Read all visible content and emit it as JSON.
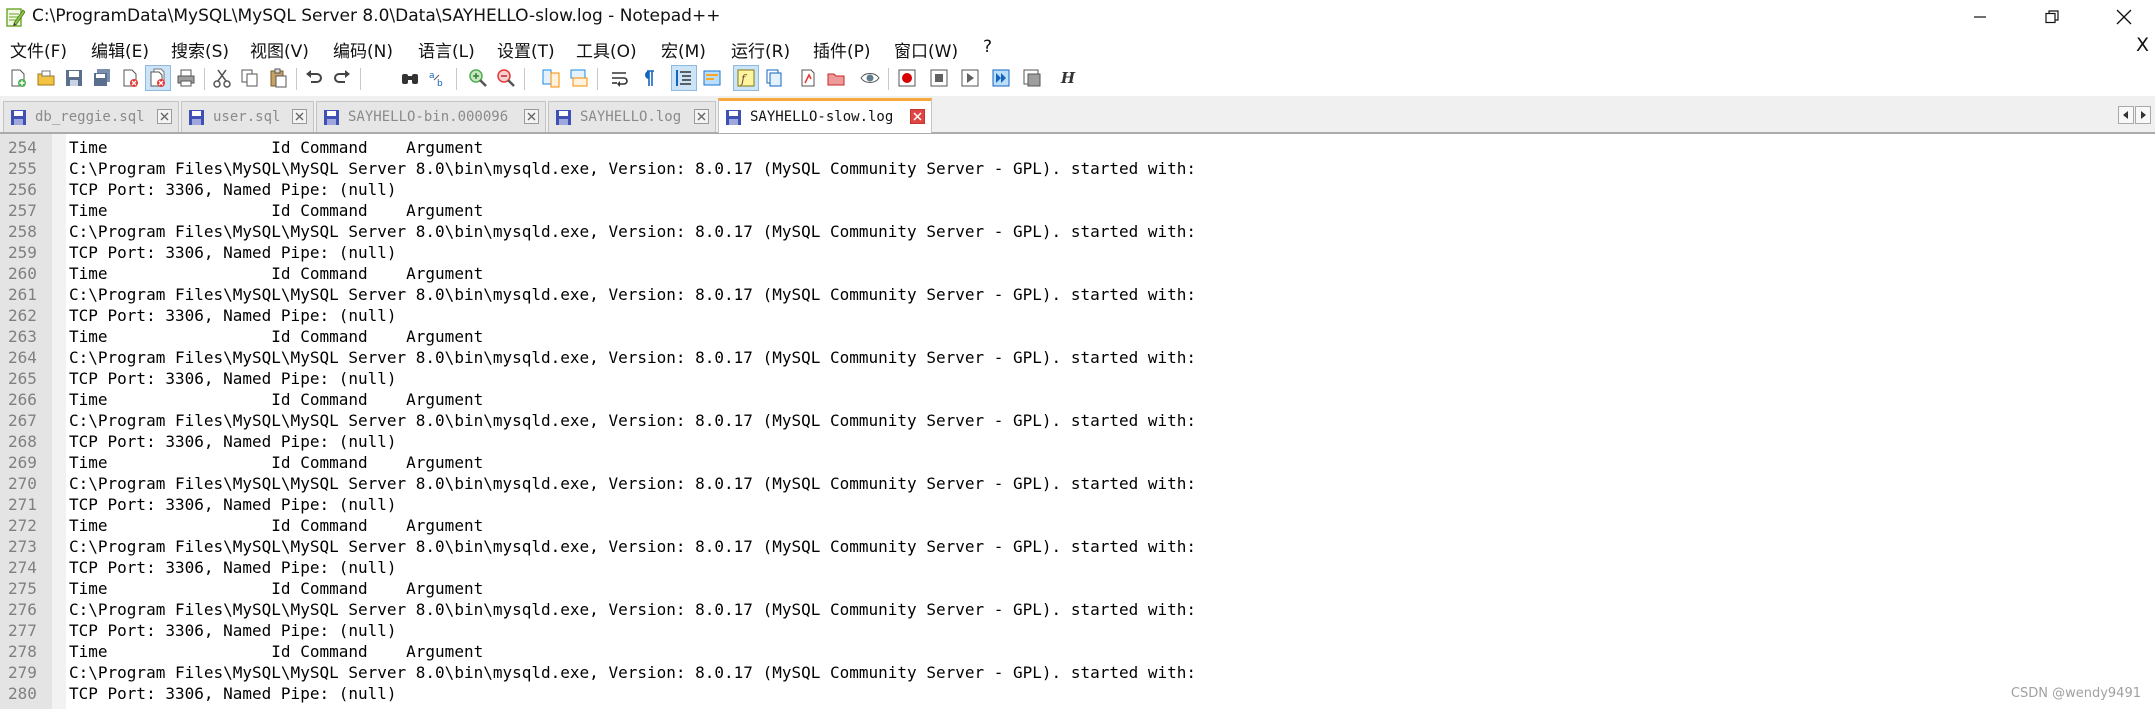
{
  "window": {
    "title": "C:\\ProgramData\\MySQL\\MySQL Server 8.0\\Data\\SAYHELLO-slow.log - Notepad++",
    "minimize": "minimize",
    "maximize": "restore",
    "close": "close"
  },
  "menu": {
    "items": [
      "文件(F)",
      "编辑(E)",
      "搜索(S)",
      "视图(V)",
      "编码(N)",
      "语言(L)",
      "设置(T)",
      "工具(O)",
      "宏(M)",
      "运行(R)",
      "插件(P)",
      "窗口(W)",
      "?"
    ],
    "close_label": "X"
  },
  "toolbar": {
    "icons": [
      "new-file-icon",
      "open-file-icon",
      "save-icon",
      "save-all-icon",
      "close-icon",
      "close-all-icon",
      "print-icon",
      "cut-icon",
      "copy-icon",
      "paste-icon",
      "undo-icon",
      "redo-icon",
      "find-icon",
      "replace-icon",
      "zoom-in-icon",
      "zoom-out-icon",
      "sync-vertical-icon",
      "sync-horizontal-icon",
      "word-wrap-icon",
      "show-all-chars-icon",
      "indent-guide-icon",
      "doc-map-icon",
      "function-list-icon",
      "folder-workspace-icon",
      "monitoring-icon",
      "record-macro-icon",
      "stop-macro-icon",
      "play-macro-icon",
      "run-macro-multiple-icon",
      "save-macro-icon",
      "hex-icon"
    ],
    "hex_label": "H"
  },
  "tabs": [
    {
      "label": "db_reggie.sql",
      "active": false
    },
    {
      "label": "user.sql",
      "active": false
    },
    {
      "label": "SAYHELLO-bin.000096",
      "active": false
    },
    {
      "label": "SAYHELLO.log",
      "active": false
    },
    {
      "label": "SAYHELLO-slow.log",
      "active": true
    }
  ],
  "editor": {
    "lines": [
      {
        "n": "254",
        "text": "Time                 Id Command    Argument"
      },
      {
        "n": "255",
        "text": "C:\\Program Files\\MySQL\\MySQL Server 8.0\\bin\\mysqld.exe, Version: 8.0.17 (MySQL Community Server - GPL). started with:"
      },
      {
        "n": "256",
        "text": "TCP Port: 3306, Named Pipe: (null)"
      },
      {
        "n": "257",
        "text": "Time                 Id Command    Argument"
      },
      {
        "n": "258",
        "text": "C:\\Program Files\\MySQL\\MySQL Server 8.0\\bin\\mysqld.exe, Version: 8.0.17 (MySQL Community Server - GPL). started with:"
      },
      {
        "n": "259",
        "text": "TCP Port: 3306, Named Pipe: (null)"
      },
      {
        "n": "260",
        "text": "Time                 Id Command    Argument"
      },
      {
        "n": "261",
        "text": "C:\\Program Files\\MySQL\\MySQL Server 8.0\\bin\\mysqld.exe, Version: 8.0.17 (MySQL Community Server - GPL). started with:"
      },
      {
        "n": "262",
        "text": "TCP Port: 3306, Named Pipe: (null)"
      },
      {
        "n": "263",
        "text": "Time                 Id Command    Argument"
      },
      {
        "n": "264",
        "text": "C:\\Program Files\\MySQL\\MySQL Server 8.0\\bin\\mysqld.exe, Version: 8.0.17 (MySQL Community Server - GPL). started with:"
      },
      {
        "n": "265",
        "text": "TCP Port: 3306, Named Pipe: (null)"
      },
      {
        "n": "266",
        "text": "Time                 Id Command    Argument"
      },
      {
        "n": "267",
        "text": "C:\\Program Files\\MySQL\\MySQL Server 8.0\\bin\\mysqld.exe, Version: 8.0.17 (MySQL Community Server - GPL). started with:"
      },
      {
        "n": "268",
        "text": "TCP Port: 3306, Named Pipe: (null)"
      },
      {
        "n": "269",
        "text": "Time                 Id Command    Argument"
      },
      {
        "n": "270",
        "text": "C:\\Program Files\\MySQL\\MySQL Server 8.0\\bin\\mysqld.exe, Version: 8.0.17 (MySQL Community Server - GPL). started with:"
      },
      {
        "n": "271",
        "text": "TCP Port: 3306, Named Pipe: (null)"
      },
      {
        "n": "272",
        "text": "Time                 Id Command    Argument"
      },
      {
        "n": "273",
        "text": "C:\\Program Files\\MySQL\\MySQL Server 8.0\\bin\\mysqld.exe, Version: 8.0.17 (MySQL Community Server - GPL). started with:"
      },
      {
        "n": "274",
        "text": "TCP Port: 3306, Named Pipe: (null)"
      },
      {
        "n": "275",
        "text": "Time                 Id Command    Argument"
      },
      {
        "n": "276",
        "text": "C:\\Program Files\\MySQL\\MySQL Server 8.0\\bin\\mysqld.exe, Version: 8.0.17 (MySQL Community Server - GPL). started with:"
      },
      {
        "n": "277",
        "text": "TCP Port: 3306, Named Pipe: (null)"
      },
      {
        "n": "278",
        "text": "Time                 Id Command    Argument"
      },
      {
        "n": "279",
        "text": "C:\\Program Files\\MySQL\\MySQL Server 8.0\\bin\\mysqld.exe, Version: 8.0.17 (MySQL Community Server - GPL). started with:"
      },
      {
        "n": "280",
        "text": "TCP Port: 3306, Named Pipe: (null)"
      }
    ]
  },
  "watermark": "CSDN @wendy9491",
  "colors": {
    "active_tab_accent": "#f8a73b",
    "tab_close_active": "#e04545",
    "gutter_bg": "#e4e4e4",
    "line_number": "#808080"
  }
}
